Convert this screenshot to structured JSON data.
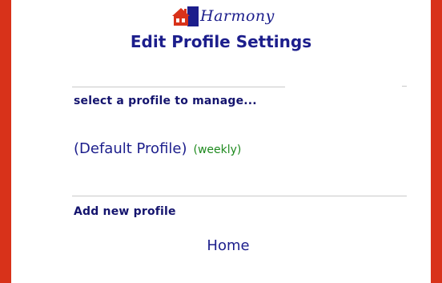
{
  "logo": {
    "brand_text": "Harmony",
    "icon": "house-icon"
  },
  "page": {
    "title": "Edit Profile Settings"
  },
  "select_section": {
    "label": "select a profile to manage..."
  },
  "profiles": [
    {
      "name": "(Default Profile)",
      "frequency": "(weekly)"
    }
  ],
  "add_section": {
    "label": "Add new profile"
  },
  "nav": {
    "home_label": "Home"
  },
  "colors": {
    "background": "#d8321a",
    "title": "#1c1e8c",
    "frequency": "#1e8a1e"
  }
}
